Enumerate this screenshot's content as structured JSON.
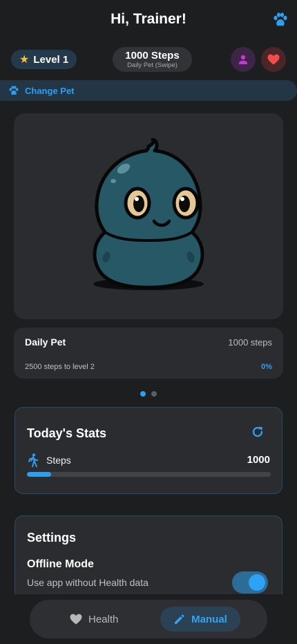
{
  "header": {
    "title": "Hi, Trainer!",
    "paw_icon": "paw-icon"
  },
  "topbar": {
    "level_label": "Level 1",
    "steps_main": "1000 Steps",
    "steps_sub": "Daily Pet (Swipe)",
    "profile_icon": "person-icon",
    "heart_icon": "heart-icon"
  },
  "change_pet": {
    "label": "Change Pet"
  },
  "pet_info": {
    "name": "Daily Pet",
    "steps": "1000 steps",
    "level_text": "2500 steps to level 2",
    "percent": "0%"
  },
  "carousel": {
    "pages": 2,
    "active": 0
  },
  "stats": {
    "title": "Today's Stats",
    "steps_label": "Steps",
    "steps_value": "1000",
    "progress": 0.1
  },
  "settings": {
    "title": "Settings",
    "offline_title": "Offline Mode",
    "offline_desc": "Use app without Health data",
    "offline_enabled": true
  },
  "nav": {
    "health_label": "Health",
    "manual_label": "Manual"
  },
  "colors": {
    "accent": "#2e9ff0",
    "pet_body": "#275866",
    "star": "#f3c230",
    "heart": "#f44b4b"
  }
}
